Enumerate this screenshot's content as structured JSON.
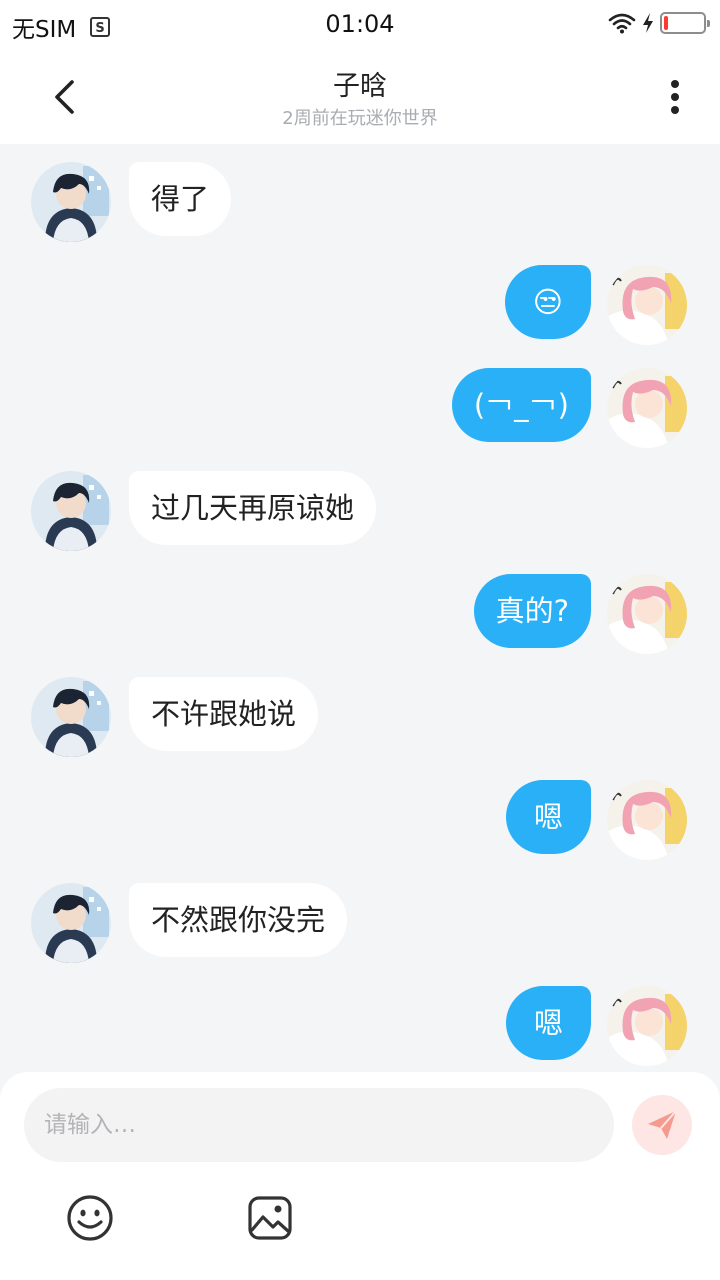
{
  "status_bar": {
    "carrier": "无SIM",
    "time": "01:04",
    "battery_level": "low",
    "colors": {
      "battery_low": "#ff3b30"
    }
  },
  "header": {
    "title": "子晗",
    "subtitle": "2周前在玩迷你世界",
    "back_icon": "chevron-left-icon",
    "more_icon": "more-vertical-icon"
  },
  "messages": [
    {
      "side": "in",
      "text": "得了"
    },
    {
      "side": "out",
      "text": "😒"
    },
    {
      "side": "out",
      "text": "(￢_￢)"
    },
    {
      "side": "in",
      "text": "过几天再原谅她"
    },
    {
      "side": "out",
      "text": "真的?"
    },
    {
      "side": "in",
      "text": "不许跟她说"
    },
    {
      "side": "out",
      "text": "嗯"
    },
    {
      "side": "in",
      "text": "不然跟你没完"
    },
    {
      "side": "out",
      "text": "嗯"
    }
  ],
  "input": {
    "placeholder": "请输入…",
    "value": "",
    "send_icon": "send-icon",
    "emoji_icon": "smiley-icon",
    "image_icon": "image-icon"
  },
  "colors": {
    "outgoing_bubble": "#29b0f7",
    "incoming_bubble": "#ffffff",
    "background": "#f4f5f7",
    "send_button_bg": "#fde6e3",
    "send_icon": "#f59a8f"
  }
}
